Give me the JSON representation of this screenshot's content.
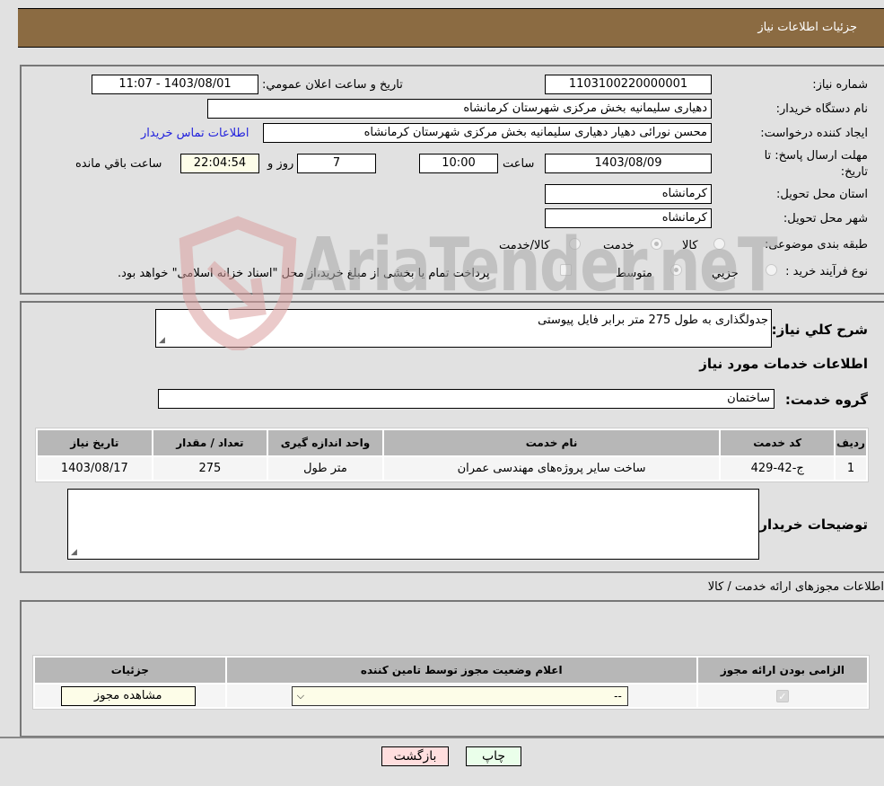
{
  "header": {
    "title": "جزئیات اطلاعات نیاز"
  },
  "details": {
    "need_number_label": "شماره نیاز:",
    "need_number": "1103100220000001",
    "announce_label": "تاریخ و ساعت اعلان عمومي:",
    "announce_value": "1403/08/01 - 11:07",
    "buyer_org_label": "نام دستگاه خریدار:",
    "buyer_org": "دهیاری سلیمانیه بخش مرکزی شهرستان کرمانشاه",
    "requester_label": "ایجاد کننده درخواست:",
    "requester": "محسن نورائی دهیار دهیاری سلیمانیه بخش مرکزی شهرستان کرمانشاه",
    "contact_link": "اطلاعات تماس خریدار",
    "deadline_label_1": "مهلت ارسال پاسخ: تا",
    "deadline_label_2": "تاریخ:",
    "deadline_date": "1403/08/09",
    "time_label": "ساعت",
    "deadline_time": "10:00",
    "days_value": "7",
    "days_label": "روز و",
    "remaining_time": "22:04:54",
    "remaining_label": "ساعت باقي مانده",
    "province_label": "استان محل تحویل:",
    "province": "کرمانشاه",
    "city_label": "شهر محل تحویل:",
    "city": "کرمانشاه",
    "category_label": "طبقه بندی موضوعی:",
    "category_options": [
      "کالا",
      "خدمت",
      "کالا/خدمت"
    ],
    "category_selected": "خدمت",
    "process_label": "نوع فرآیند خرید :",
    "process_options": [
      "جزيي",
      "متوسط"
    ],
    "process_selected": "متوسط",
    "treasury_note": "پرداخت تمام یا بخشی از مبلغ خرید،از محل \"اسناد خزانه اسلامی\" خواهد بود."
  },
  "description": {
    "general_label": "شرح کلي نیاز:",
    "general_value": "جدولگذاری به طول 275 متر برابر فایل پیوستی",
    "services_title": "اطلاعات خدمات مورد نیاز",
    "group_label": "گروه خدمت:",
    "group_value": "ساختمان"
  },
  "services_table": {
    "headers": [
      "ردیف",
      "کد خدمت",
      "نام خدمت",
      "واحد اندازه گیری",
      "تعداد / مقدار",
      "تاریخ نیاز"
    ],
    "rows": [
      [
        "1",
        "ج-42-429",
        "ساخت سایر پروژه‌های مهندسی عمران",
        "متر طول",
        "275",
        "1403/08/17"
      ]
    ]
  },
  "buyer_notes": {
    "label": "توضیحات خریدار:",
    "value": ""
  },
  "permits": {
    "title": "اطلاعات مجوزهای ارائه خدمت / کالا",
    "headers": [
      "الزامی بودن ارائه مجوز",
      "اعلام وضعیت مجوز توسط تامین کننده",
      "جزئیات"
    ],
    "row": {
      "required_checked": true,
      "status_selected": "--",
      "details_button": "مشاهده مجوز"
    }
  },
  "buttons": {
    "print": "چاپ",
    "back": "بازگشت"
  },
  "watermark": {
    "text": "AriaTender.neT"
  },
  "colors": {
    "header_bg": "#8b6b42",
    "print_bg": "#eaffea",
    "back_bg": "#ffdede",
    "link": "#2222dd"
  }
}
